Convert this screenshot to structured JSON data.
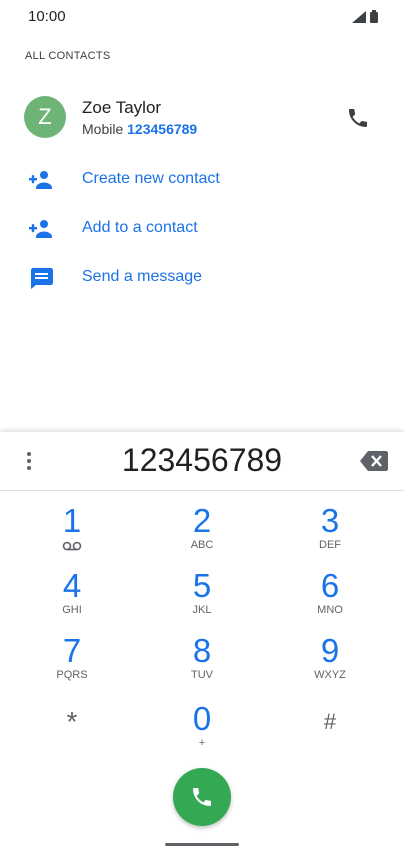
{
  "status_bar": {
    "time": "10:00"
  },
  "section_header": "ALL CONTACTS",
  "contact": {
    "avatar_letter": "Z",
    "name": "Zoe Taylor",
    "type": "Mobile",
    "number": "123456789"
  },
  "actions": [
    {
      "label": "Create new contact",
      "icon": "add-person-icon"
    },
    {
      "label": "Add to a contact",
      "icon": "add-person-icon"
    },
    {
      "label": "Send a message",
      "icon": "message-icon"
    }
  ],
  "dialpad": {
    "entered_digits": "123456789",
    "keys": [
      {
        "digit": "1",
        "letters": ""
      },
      {
        "digit": "2",
        "letters": "ABC"
      },
      {
        "digit": "3",
        "letters": "DEF"
      },
      {
        "digit": "4",
        "letters": "GHI"
      },
      {
        "digit": "5",
        "letters": "JKL"
      },
      {
        "digit": "6",
        "letters": "MNO"
      },
      {
        "digit": "7",
        "letters": "PQRS"
      },
      {
        "digit": "8",
        "letters": "TUV"
      },
      {
        "digit": "9",
        "letters": "WXYZ"
      },
      {
        "digit": "*",
        "letters": ""
      },
      {
        "digit": "0",
        "letters": "+"
      },
      {
        "digit": "#",
        "letters": ""
      }
    ]
  },
  "colors": {
    "accent": "#1a73e8",
    "call_green": "#34a853",
    "avatar": "#6fb477"
  }
}
